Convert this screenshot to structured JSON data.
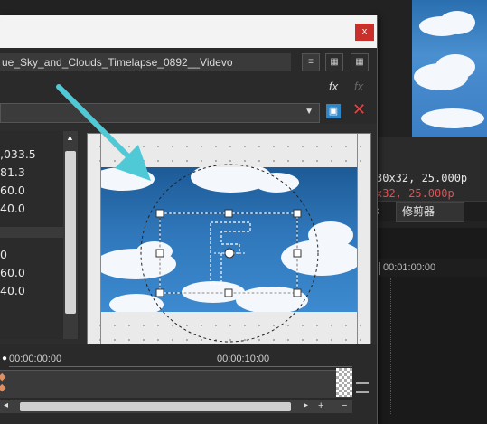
{
  "dialog": {
    "close_label": "x",
    "file_name": "ue_Sky_and_Clouds_Timelapse_0892__Videvo",
    "view_buttons": [
      "list-icon",
      "grid-icon",
      "tiles-icon"
    ],
    "fx_icon_1": "fx",
    "fx_icon_2": "fx",
    "preset_arrow": "▼",
    "save_icon": "floppy-save-icon",
    "delete_icon": "✕"
  },
  "params": {
    "values": [
      ",033.5",
      "81.3",
      "60.0",
      "40.0",
      "0",
      "60.0",
      "40.0"
    ]
  },
  "right_panel": {
    "info_line_1": "30x32, 25.000p",
    "info_line_2": "x32, 25.000p",
    "info_line_2_color": "#e05050",
    "tab_label": "修剪器",
    "tab_left_glyph": "k",
    "ruler_time": "00:01:00:00"
  },
  "timeline": {
    "start_time": "00:00:00:00",
    "mid_time": "00:00:10:00",
    "plus_label": "+",
    "minus_label": "−",
    "right_arrow": "▸",
    "left_arrow": "◂"
  },
  "colors": {
    "arrow": "#4fc9d6",
    "close_button": "#c9302c",
    "save_icon": "#2d86c8",
    "delete_icon": "#e04545"
  }
}
